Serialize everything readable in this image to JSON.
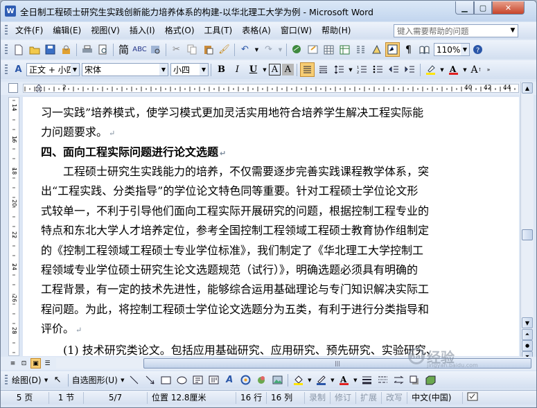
{
  "window": {
    "title": "全日制工程硕士研究生实践创新能力培养体系的构建-以华北理工大学为例 - Microsoft Word",
    "app_icon": "W",
    "min": "0",
    "max": "1",
    "close": "r"
  },
  "menu": {
    "items": [
      "文件(F)",
      "编辑(E)",
      "视图(V)",
      "插入(I)",
      "格式(O)",
      "工具(T)",
      "表格(A)",
      "窗口(W)",
      "帮助(H)"
    ],
    "help_placeholder": "键入需要帮助的问题"
  },
  "toolbar_standard": {
    "simplified_chinese_label": "简",
    "zoom": "110%"
  },
  "toolbar_format": {
    "style": "正文 + 小四",
    "font": "宋体",
    "size": "小四"
  },
  "document": {
    "lines": [
      {
        "text": "习一实践”培养模式，使学习模式更加灵活实用地符合培养学生解决工程实际能",
        "indent": false,
        "bold": false,
        "ret": false
      },
      {
        "text": "力问题要求。",
        "indent": false,
        "bold": false,
        "ret": true
      },
      {
        "text": "四、面向工程实际问题进行论文选题",
        "indent": false,
        "bold": true,
        "ret": true
      },
      {
        "text": "工程硕士研究生实践能力的培养，不仅需要逐步完善实践课程教学体系，突",
        "indent": true,
        "bold": false,
        "ret": false
      },
      {
        "text": "出“工程实践、分类指导”的学位论文特色同等重要。针对工程硕士学位论文形",
        "indent": false,
        "bold": false,
        "ret": false
      },
      {
        "text": "式较单一，不利于引导他们面向工程实际开展研究的问题，根据控制工程专业的",
        "indent": false,
        "bold": false,
        "ret": false
      },
      {
        "text": "特点和东北大学人才培养定位，参考全国控制工程领域工程硕士教育协作组制定",
        "indent": false,
        "bold": false,
        "ret": false
      },
      {
        "text": "的《控制工程领域工程硕士专业学位标准》，我们制定了《华北理工大学控制工",
        "indent": false,
        "bold": false,
        "ret": false
      },
      {
        "text": "程领域专业学位硕士研究生论文选题规范（试行）》，明确选题必须具有明确的",
        "indent": false,
        "bold": false,
        "ret": false
      },
      {
        "text": "工程背景，有一定的技术先进性，能够综合运用基础理论与专门知识解决实际工",
        "indent": false,
        "bold": false,
        "ret": false
      },
      {
        "text": "程问题。为此，将控制工程硕士学位论文选题分为五类，有利于进行分类指导和",
        "indent": false,
        "bold": false,
        "ret": false
      },
      {
        "text": "评价。",
        "indent": false,
        "bold": false,
        "ret": true
      },
      {
        "text": "(1) 技术研究类论文。包括应用基础研究、应用研究、预先研究、实验研究、",
        "indent": true,
        "bold": false,
        "ret": false
      }
    ]
  },
  "rulers": {
    "h_labels": [
      "2",
      "40",
      "42",
      "44"
    ],
    "v_labels": [
      "14",
      "16",
      "18",
      "20",
      "22",
      "24",
      "26",
      "28"
    ]
  },
  "drawing_toolbar": {
    "draw_label": "绘图(D)",
    "autoshape_label": "自选图形(U)"
  },
  "statusbar": {
    "page": "5 页",
    "section": "1 节",
    "page_of": "5/7",
    "position": "位置 12.8厘米",
    "line": "16 行",
    "column": "16 列",
    "rec": "录制",
    "trk": "修订",
    "ext": "扩展",
    "ovr": "改写",
    "language": "中文(中国)"
  },
  "watermark": {
    "text": "经验",
    "sub": "jingyan.baidu.com"
  }
}
